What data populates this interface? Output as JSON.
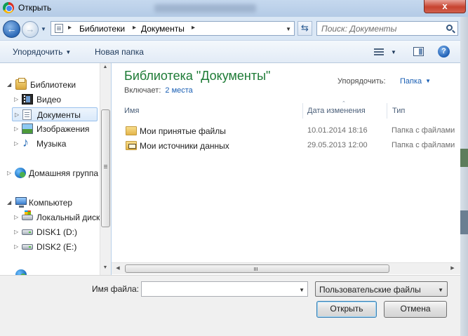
{
  "window": {
    "title": "Открыть",
    "close_label": "x"
  },
  "address": {
    "crumbs": [
      "Библиотеки",
      "Документы"
    ],
    "separator": "▸",
    "search_placeholder": "Поиск: Документы"
  },
  "toolbar": {
    "organize_label": "Упорядочить",
    "new_folder_label": "Новая папка",
    "help_label": "?"
  },
  "nav": {
    "items": [
      {
        "label": "Библиотеки",
        "icon": "library-icon"
      },
      {
        "label": "Видео",
        "icon": "video-icon"
      },
      {
        "label": "Документы",
        "icon": "documents-icon",
        "selected": true
      },
      {
        "label": "Изображения",
        "icon": "pictures-icon"
      },
      {
        "label": "Музыка",
        "icon": "music-icon"
      },
      {
        "label": "Домашняя группа",
        "icon": "homegroup-icon"
      },
      {
        "label": "Компьютер",
        "icon": "computer-icon"
      },
      {
        "label": "Локальный диск",
        "icon": "system-drive-icon"
      },
      {
        "label": "DISK1 (D:)",
        "icon": "drive-icon"
      },
      {
        "label": "DISK2 (E:)",
        "icon": "drive-icon"
      }
    ]
  },
  "library": {
    "title": "Библиотека \"Документы\"",
    "includes_label": "Включает:",
    "includes_link": "2 места",
    "arrange_label": "Упорядочить:",
    "arrange_value": "Папка"
  },
  "columns": {
    "name": "Имя",
    "date": "Дата изменения",
    "type": "Тип"
  },
  "files": [
    {
      "name": "Мои принятые файлы",
      "date": "10.01.2014 18:16",
      "type": "Папка с файлами"
    },
    {
      "name": "Мои источники данных",
      "date": "29.05.2013 12:00",
      "type": "Папка с файлами"
    }
  ],
  "bottom": {
    "filename_label": "Имя файла:",
    "filename_value": "",
    "filter_value": "Пользовательские файлы",
    "open_label": "Открыть",
    "cancel_label": "Отмена"
  },
  "colors": {
    "library_title": "#1e7b36",
    "link": "#1a5fb4",
    "selection": "#d9e9fa"
  }
}
